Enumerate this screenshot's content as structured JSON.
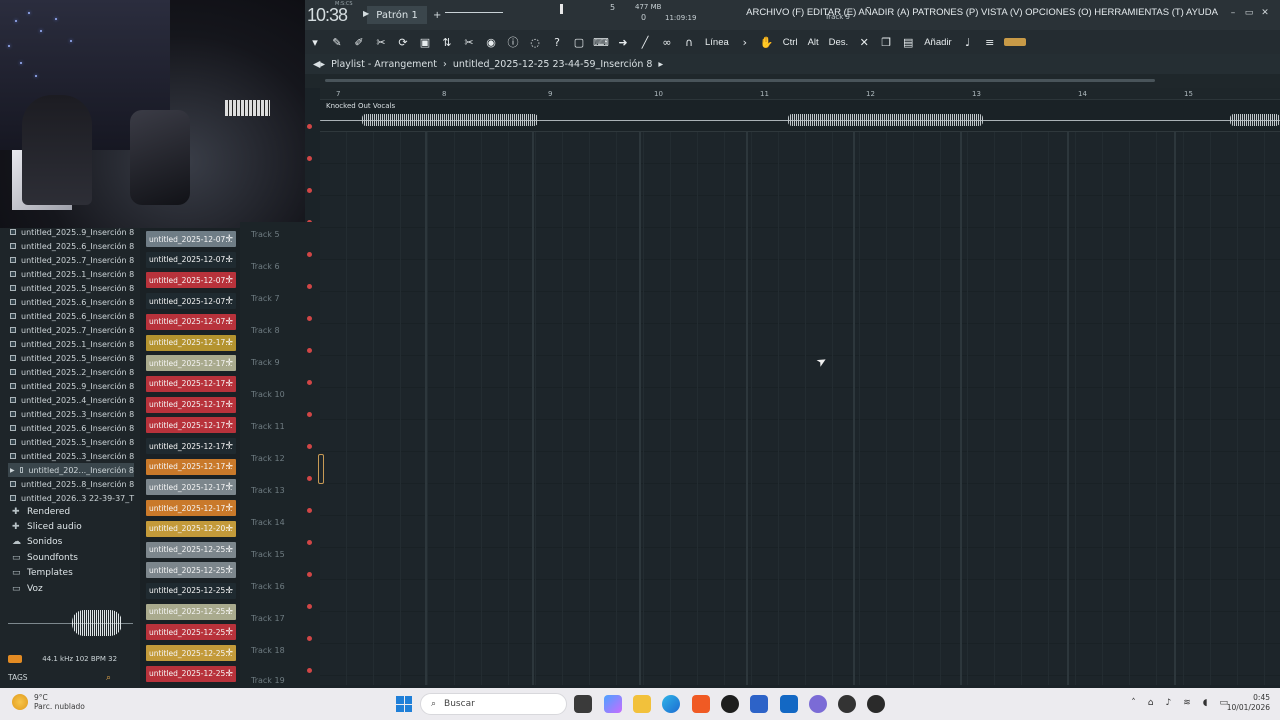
{
  "topbar": {
    "time": "10:38",
    "time_top": "M:S:CS",
    "pattern": "Patrón 1",
    "pattern_plus": "+",
    "bpm_top": "5",
    "bpm_bottom": "0",
    "mem_top": "477 MB",
    "mem_bottom": "11:09:19",
    "track_hint": "Track 9",
    "menu": "ARCHIVO (F) EDITAR (E) AÑADIR (A) PATRONES (P) VISTA (V) OPCIONES (O) HERRAMIENTAS (T) AYUDA",
    "win_min": "–",
    "win_max": "▭",
    "win_close": "✕"
  },
  "toolbar": {
    "line_label": "Línea",
    "ctrl_label": "Ctrl",
    "alt_label": "Alt",
    "des_label": "Des.",
    "add_label": "Añadir"
  },
  "playlist": {
    "title": "Playlist - Arrangement",
    "file": "untitled_2025-12-25 23-44-59_Inserción 8",
    "clip_label": "Knocked Out Vocals",
    "bars": [
      "7",
      "8",
      "9",
      "10",
      "11",
      "12",
      "13",
      "14",
      "15"
    ],
    "tracks": [
      "Track 5",
      "Track 6",
      "Track 7",
      "Track 8",
      "Track 9",
      "Track 10",
      "Track 11",
      "Track 12",
      "Track 13",
      "Track 14",
      "Track 15",
      "Track 16",
      "Track 17",
      "Track 18",
      "Track 19"
    ]
  },
  "browser": {
    "files": [
      "untitled_2025..9_Inserción 8",
      "untitled_2025..6_Inserción 8",
      "untitled_2025..7_Inserción 8",
      "untitled_2025..1_Inserción 8",
      "untitled_2025..5_Inserción 8",
      "untitled_2025..6_Inserción 8",
      "untitled_2025..6_Inserción 8",
      "untitled_2025..7_Inserción 8",
      "untitled_2025..1_Inserción 8",
      "untitled_2025..5_Inserción 8",
      "untitled_2025..2_Inserción 8",
      "untitled_2025..9_Inserción 8",
      "untitled_2025..4_Inserción 8",
      "untitled_2025..3_Inserción 8",
      "untitled_2025..6_Inserción 8",
      "untitled_2025..5_Inserción 8",
      "untitled_2025..3_Inserción 8",
      "untitled_202..._Inserción 8",
      "untitled_2025..8_Inserción 8",
      "untitled_2026..3 22-39-37_T"
    ],
    "folders": [
      "Rendered",
      "Sliced audio",
      "Sonidos",
      "Soundfonts",
      "Templates",
      "Voz"
    ],
    "info": "44.1 kHz 102 BPM 32",
    "tags": "TAGS"
  },
  "clips": [
    {
      "label": "untitled_2025-12-07...",
      "color": "#6f7d86"
    },
    {
      "label": "untitled_2025-12-07...",
      "color": "#1f2a30"
    },
    {
      "label": "untitled_2025-12-07...",
      "color": "#b8323b"
    },
    {
      "label": "untitled_2025-12-07...",
      "color": "#1f2a30"
    },
    {
      "label": "untitled_2025-12-07...",
      "color": "#b8323b"
    },
    {
      "label": "untitled_2025-12-17...",
      "color": "#b4932f"
    },
    {
      "label": "untitled_2025-12-17...",
      "color": "#a9aa8d"
    },
    {
      "label": "untitled_2025-12-17...",
      "color": "#b8323b"
    },
    {
      "label": "untitled_2025-12-17...",
      "color": "#b8323b"
    },
    {
      "label": "untitled_2025-12-17...",
      "color": "#b8323b"
    },
    {
      "label": "untitled_2025-12-17...",
      "color": "#1f2a30"
    },
    {
      "label": "untitled_2025-12-17...",
      "color": "#c9792a"
    },
    {
      "label": "untitled_2025-12-17...",
      "color": "#7c868c"
    },
    {
      "label": "untitled_2025-12-17...",
      "color": "#c9792a"
    },
    {
      "label": "untitled_2025-12-20...",
      "color": "#c39a3a"
    },
    {
      "label": "untitled_2025-12-25...",
      "color": "#7c868c"
    },
    {
      "label": "untitled_2025-12-25...",
      "color": "#7c868c"
    },
    {
      "label": "untitled_2025-12-25...",
      "color": "#1f2a30"
    },
    {
      "label": "untitled_2025-12-25...",
      "color": "#a9aa8d"
    },
    {
      "label": "untitled_2025-12-25...",
      "color": "#b8323b"
    },
    {
      "label": "untitled_2025-12-25...",
      "color": "#c39a3a"
    },
    {
      "label": "untitled_2025-12-25...",
      "color": "#b8323b"
    }
  ],
  "taskbar": {
    "weather_temp": "9°C",
    "weather_desc": "Parc. nublado",
    "search_placeholder": "Buscar",
    "clock_time": "0:45",
    "clock_date": "10/01/2026"
  }
}
